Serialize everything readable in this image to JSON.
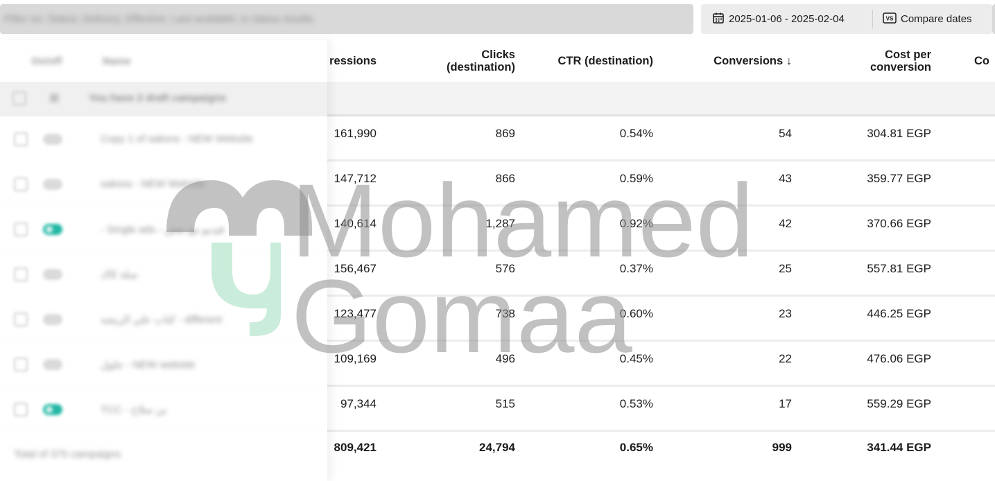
{
  "toolbar": {
    "search_placeholder": "Filter on: Status: Delivery; Effective: Last available; in status results",
    "date_range": "2025-01-06 - 2025-02-04",
    "compare_label": "Compare dates",
    "calendar_icon": "calendar-icon",
    "vs_icon": "vs-icon"
  },
  "columns": {
    "onoff": "On/off",
    "name": "Name",
    "impressions": "ressions",
    "clicks": "Clicks (destination)",
    "clicks_line1": "Clicks",
    "clicks_line2": "(destination)",
    "ctr": "CTR (destination)",
    "conversions": "Conversions ↓",
    "cost_line1": "Cost per",
    "cost_line2": "conversion",
    "partial": "Co"
  },
  "draft_row": {
    "label": "You have 2 draft campaigns"
  },
  "rows": [
    {
      "name": "Copy 1 of sakora - NEW Website",
      "on": false,
      "impressions": "161,990",
      "clicks": "869",
      "ctr": "0.54%",
      "conversions": "54",
      "cost": "304.81 EGP"
    },
    {
      "name": "sakora - NEW Website",
      "on": false,
      "impressions": "147,712",
      "clicks": "866",
      "ctr": "0.59%",
      "conversions": "43",
      "cost": "359.77 EGP"
    },
    {
      "name": "- Single ads - فيديو مع بعض",
      "on": true,
      "impressions": "140,614",
      "clicks": "1,287",
      "ctr": "0.92%",
      "conversions": "42",
      "cost": "370.66 EGP"
    },
    {
      "name": "سلة كاك",
      "on": false,
      "impressions": "156,467",
      "clicks": "576",
      "ctr": "0.37%",
      "conversions": "25",
      "cost": "557.81 EGP"
    },
    {
      "name": "كتاب علي الريشه - different",
      "on": false,
      "impressions": "123,477",
      "clicks": "738",
      "ctr": "0.60%",
      "conversions": "23",
      "cost": "446.25 EGP"
    },
    {
      "name": "جلول - NEW website",
      "on": false,
      "impressions": "109,169",
      "clicks": "496",
      "ctr": "0.45%",
      "conversions": "22",
      "cost": "476.06 EGP"
    },
    {
      "name": "TCC - بن سلاح",
      "on": true,
      "impressions": "97,344",
      "clicks": "515",
      "ctr": "0.53%",
      "conversions": "17",
      "cost": "559.29 EGP"
    }
  ],
  "total": {
    "label": "Total of 375 campaigns",
    "impressions": "809,421",
    "clicks": "24,794",
    "ctr": "0.65%",
    "conversions": "999",
    "cost": "341.44 EGP"
  },
  "watermark": {
    "line1": "Mohamed",
    "line2": "Gomaa"
  },
  "colors": {
    "toggle_on": "#23b8a6",
    "watermark_gray": "#9a9a9a",
    "watermark_green": "#a8e3c3"
  }
}
